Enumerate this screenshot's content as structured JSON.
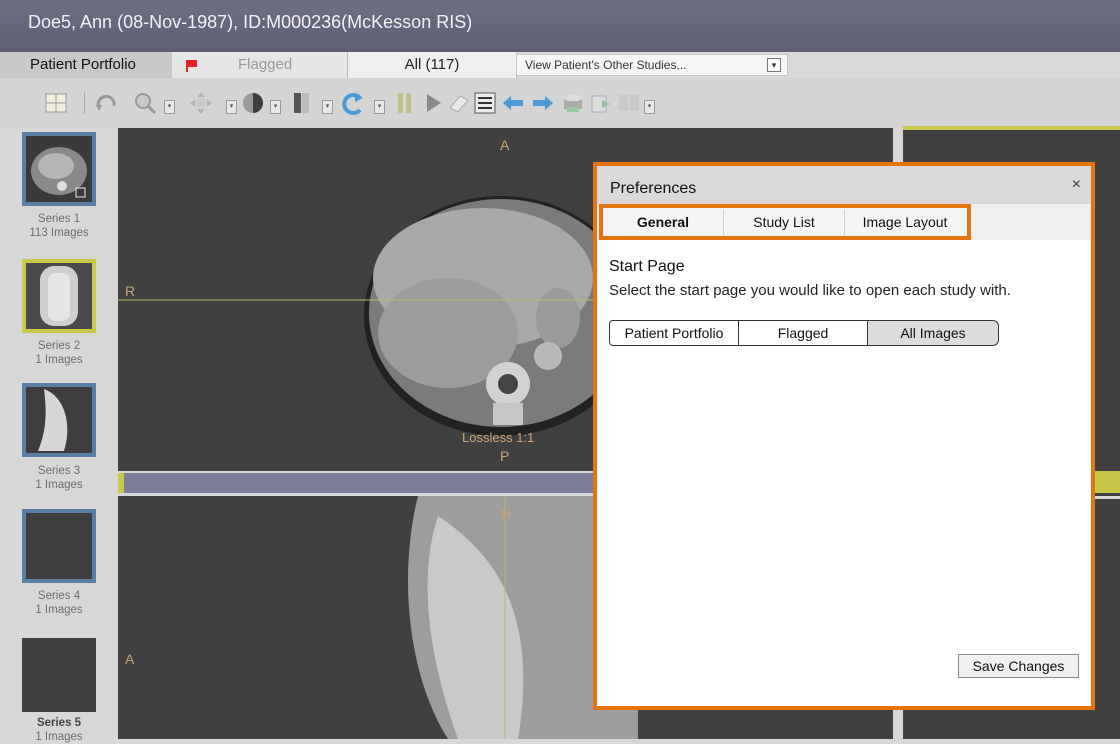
{
  "window": {
    "title": "Doe5, Ann (08-Nov-1987), ID:M000236(McKesson RIS)"
  },
  "tabs": {
    "patient_portfolio": "Patient Portfolio",
    "flagged": "Flagged",
    "all": "All (117)",
    "other_studies": {
      "selected": "View Patient's Other Studies...",
      "arrow": "▾"
    }
  },
  "toolbar": {
    "icons": [
      "layout-grid-icon",
      "rotate-icon",
      "zoom-icon",
      "pan-icon",
      "window-level-icon",
      "flip-icon",
      "reset-icon",
      "cine-icon",
      "play-icon",
      "eraser-icon",
      "list-icon",
      "arrow-left-icon",
      "arrow-right-icon",
      "print-icon",
      "export-icon",
      "compare-icon"
    ]
  },
  "series": [
    {
      "label": "Series 1",
      "count": "113 Images"
    },
    {
      "label": "Series 2",
      "count": "1 Images"
    },
    {
      "label": "Series 3",
      "count": "1 Images"
    },
    {
      "label": "Series 4",
      "count": "1 Images"
    },
    {
      "label": "Series 5",
      "count": "1 Images"
    }
  ],
  "viewer": {
    "top": {
      "orient_top": "A",
      "orient_left": "R",
      "orient_bottom": "P",
      "compression": "Lossless 1:1"
    },
    "bottom": {
      "orient_top": "H",
      "orient_left": "A"
    }
  },
  "preferences": {
    "title": "Preferences",
    "close": "×",
    "tabs": {
      "general": "General",
      "study_list": "Study List",
      "image_layout": "Image Layout"
    },
    "start_page": {
      "heading": "Start Page",
      "description": "Select the start page you would like to open each study with.",
      "options": {
        "portfolio": "Patient Portfolio",
        "flagged": "Flagged",
        "all_images": "All Images"
      },
      "selected": "All Images"
    },
    "save": "Save Changes"
  },
  "colors": {
    "accent_orange": "#e47311",
    "selection_yellow": "#c9c94a",
    "thumb_border_blue": "#5a7fa6",
    "flag_red": "#e8202a"
  }
}
